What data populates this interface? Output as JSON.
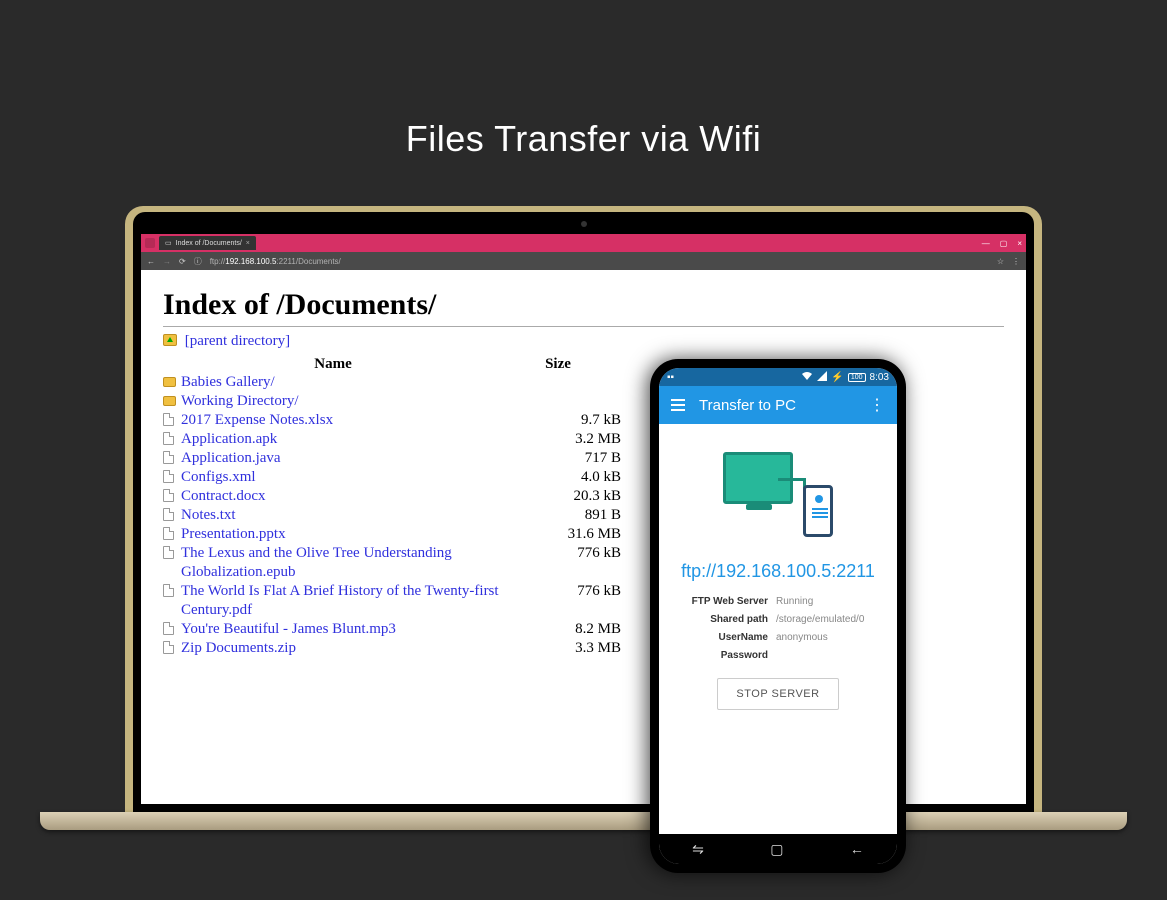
{
  "headline": "Files Transfer via Wifi",
  "browser": {
    "tab_title": "Index of /Documents/",
    "url_display": "192.168.100.5",
    "url_suffix": ":2211/Documents/"
  },
  "page": {
    "title": "Index of /Documents/",
    "parent_label": "[parent directory]",
    "col_name": "Name",
    "col_size": "Size",
    "items": [
      {
        "type": "folder",
        "name": "Babies Gallery/",
        "size": ""
      },
      {
        "type": "folder",
        "name": "Working Directory/",
        "size": ""
      },
      {
        "type": "file",
        "name": "2017 Expense Notes.xlsx",
        "size": "9.7 kB"
      },
      {
        "type": "file",
        "name": "Application.apk",
        "size": "3.2 MB"
      },
      {
        "type": "file",
        "name": "Application.java",
        "size": "717 B"
      },
      {
        "type": "file",
        "name": "Configs.xml",
        "size": "4.0 kB"
      },
      {
        "type": "file",
        "name": "Contract.docx",
        "size": "20.3 kB"
      },
      {
        "type": "file",
        "name": "Notes.txt",
        "size": "891 B"
      },
      {
        "type": "file",
        "name": "Presentation.pptx",
        "size": "31.6 MB"
      },
      {
        "type": "file",
        "name": "The Lexus and the Olive Tree Understanding Globalization.epub",
        "size": "776 kB"
      },
      {
        "type": "file",
        "name": "The World Is Flat A Brief History of the Twenty-first Century.pdf",
        "size": "776 kB"
      },
      {
        "type": "file",
        "name": "You're Beautiful - James Blunt.mp3",
        "size": "8.2 MB"
      },
      {
        "type": "file",
        "name": "Zip Documents.zip",
        "size": "3.3 MB"
      }
    ]
  },
  "phone": {
    "status_battery": "100",
    "status_time": "8:03",
    "app_title": "Transfer to PC",
    "ftp_url": "ftp://192.168.100.5:2211",
    "rows": [
      {
        "k": "FTP Web Server",
        "v": "Running"
      },
      {
        "k": "Shared path",
        "v": "/storage/emulated/0"
      },
      {
        "k": "UserName",
        "v": "anonymous"
      },
      {
        "k": "Password",
        "v": ""
      }
    ],
    "stop_label": "STOP SERVER"
  }
}
